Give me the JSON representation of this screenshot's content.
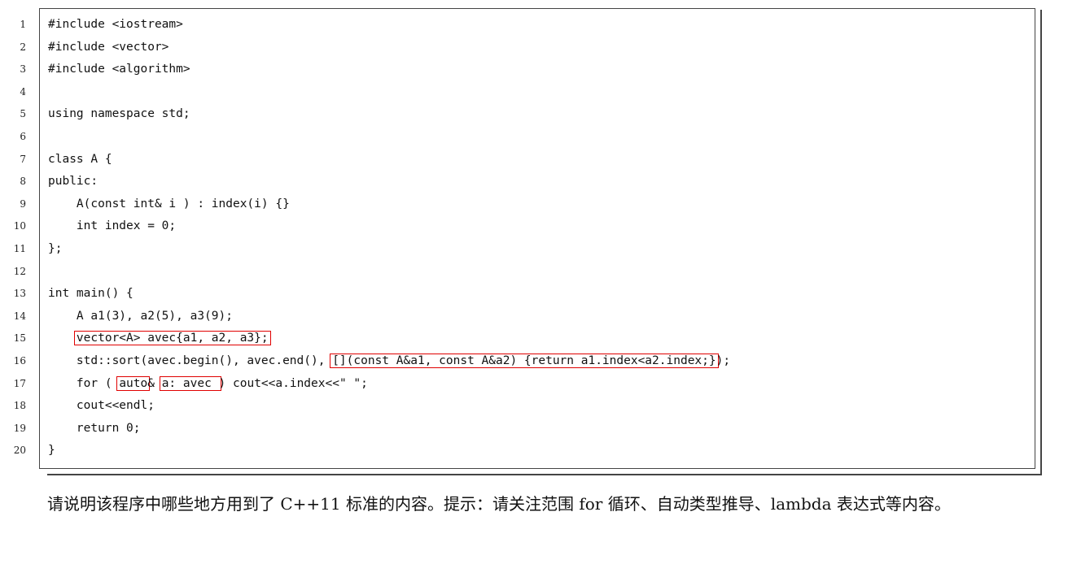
{
  "code_lines": [
    {
      "n": "1",
      "pre": "#include <iostream>"
    },
    {
      "n": "2",
      "pre": "#include <vector>"
    },
    {
      "n": "3",
      "pre": "#include <algorithm>"
    },
    {
      "n": "4",
      "pre": ""
    },
    {
      "n": "5",
      "pre": "using namespace std;"
    },
    {
      "n": "6",
      "pre": ""
    },
    {
      "n": "7",
      "pre": "class A {"
    },
    {
      "n": "8",
      "pre": "public:"
    },
    {
      "n": "9",
      "pre": "    A(const int& i ) : index(i) {}"
    },
    {
      "n": "10",
      "pre": "    int index = 0;"
    },
    {
      "n": "11",
      "pre": "};"
    },
    {
      "n": "12",
      "pre": ""
    },
    {
      "n": "13",
      "pre": "int main() {"
    },
    {
      "n": "14",
      "pre": "    A a1(3), a2(5), a3(9);"
    },
    {
      "n": "15",
      "pre": "    ",
      "box1": "vector<A> avec{a1, a2, a3};"
    },
    {
      "n": "16",
      "pre": "    std::sort(avec.begin(), avec.end(), ",
      "box1": "[](const A&a1, const A&a2) {return a1.index<a2.index;}",
      "post": ");"
    },
    {
      "n": "17",
      "pre": "    for ( ",
      "box1": "auto",
      "mid": "& ",
      "box2": "a: avec ",
      "post": ") cout<<a.index<<\" \";"
    },
    {
      "n": "18",
      "pre": "    cout<<endl;"
    },
    {
      "n": "19",
      "pre": "    return 0;"
    },
    {
      "n": "20",
      "pre": "}"
    }
  ],
  "question": "请说明该程序中哪些地方用到了 C++11 标准的内容。提示：请关注范围 for 循环、自动类型推导、lambda 表达式等内容。"
}
